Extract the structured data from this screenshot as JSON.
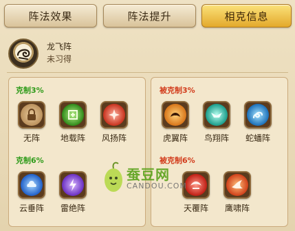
{
  "tabs": [
    {
      "label": "阵法效果",
      "active": false
    },
    {
      "label": "阵法提升",
      "active": false
    },
    {
      "label": "相克信息",
      "active": true
    }
  ],
  "formation": {
    "name": "龙飞阵",
    "status": "未习得",
    "icon": "dragon-emblem-icon"
  },
  "restrains": {
    "group1": {
      "label": "克制3%",
      "items": [
        {
          "name": "无阵",
          "icon": "lock-icon"
        },
        {
          "name": "地载阵",
          "icon": "earth-emblem-icon"
        },
        {
          "name": "风扬阵",
          "icon": "wind-emblem-icon"
        }
      ]
    },
    "group2": {
      "label": "克制6%",
      "items": [
        {
          "name": "云垂阵",
          "icon": "cloud-emblem-icon"
        },
        {
          "name": "雷绝阵",
          "icon": "thunder-emblem-icon"
        }
      ]
    }
  },
  "restrained_by": {
    "group1": {
      "label": "被克制3%",
      "items": [
        {
          "name": "虎翼阵",
          "icon": "tiger-emblem-icon"
        },
        {
          "name": "鸟翔阵",
          "icon": "bird-emblem-icon"
        },
        {
          "name": "蛇蟠阵",
          "icon": "snake-emblem-icon"
        }
      ]
    },
    "group2": {
      "label": "被克制6%",
      "items": [
        {
          "name": "天覆阵",
          "icon": "sky-emblem-icon"
        },
        {
          "name": "鹰啸阵",
          "icon": "eagle-emblem-icon"
        }
      ]
    }
  },
  "watermark": {
    "text": "蚕豆网",
    "subtext": "CANDOU.COM",
    "icon": "bean-mascot-icon"
  },
  "colors": {
    "restrain": "#2f9b1a",
    "restrained": "#d23c1c",
    "active_tab": "#e3a92c"
  }
}
